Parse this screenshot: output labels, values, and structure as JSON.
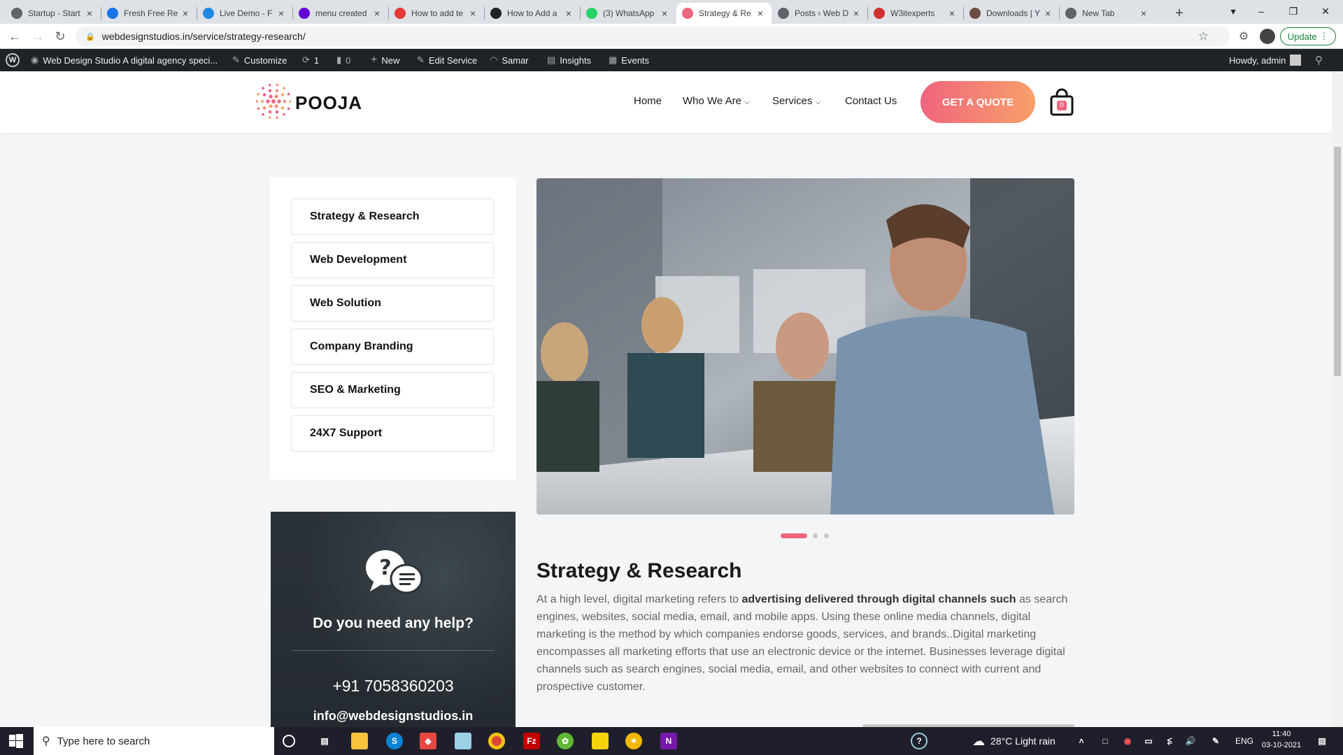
{
  "browser": {
    "tabs": [
      {
        "title": "Startup - Start",
        "icon": "globe-icon",
        "color": "#5f6368"
      },
      {
        "title": "Fresh Free Re",
        "icon": "f-icon",
        "color": "#1a73e8"
      },
      {
        "title": "Live Demo - F",
        "icon": "web-icon",
        "color": "#1e88e5"
      },
      {
        "title": "menu created",
        "icon": "yahoo-icon",
        "color": "#6001d2"
      },
      {
        "title": "How to add te",
        "icon": "adobe-icon",
        "color": "#e53935"
      },
      {
        "title": "How to Add a",
        "icon": "co-icon",
        "color": "#202124"
      },
      {
        "title": "(3) WhatsApp",
        "icon": "whatsapp-icon",
        "color": "#25d366"
      },
      {
        "title": "Strategy & Re",
        "icon": "site-icon",
        "color": "#f0657e",
        "active": true
      },
      {
        "title": "Posts ‹ Web D",
        "icon": "wordpress-icon",
        "color": "#5f6368"
      },
      {
        "title": "W3itexperts",
        "icon": "w-icon",
        "color": "#d32f2f"
      },
      {
        "title": "Downloads | Y",
        "icon": "download-icon",
        "color": "#6d4c41"
      },
      {
        "title": "New Tab",
        "icon": "globe-icon",
        "color": "#5f6368"
      }
    ],
    "new_tab": "+",
    "url": "webdesignstudios.in/service/strategy-research/",
    "update_label": "Update"
  },
  "wpbar": {
    "site": "Web Design Studio A digital agency speci...",
    "customize": "Customize",
    "updates": "1",
    "comments": "0",
    "new": "New",
    "edit": "Edit Service",
    "samar": "Samar",
    "insights": "Insights",
    "events": "Events",
    "howdy": "Howdy, admin"
  },
  "site": {
    "logo": "POOJA",
    "nav": [
      "Home",
      "Who We Are",
      "Services",
      "Contact Us"
    ],
    "quote": "GET A QUOTE",
    "cart_count": "0"
  },
  "services": [
    "Strategy & Research",
    "Web Development",
    "Web Solution",
    "Company Branding",
    "SEO & Marketing",
    "24X7 Support"
  ],
  "help": {
    "title": "Do you need any help?",
    "phone": "+91 7058360203",
    "email": "info@webdesignstudios.in"
  },
  "main": {
    "title": "Strategy & Research",
    "para_pre": "At a high level, digital marketing refers to ",
    "para_bold": "advertising delivered through digital channels such",
    "para_post": " as search engines, websites, social media, email, and mobile apps. Using these online media channels, digital marketing is the method by which companies endorse goods, services, and brands..Digital marketing encompasses all marketing efforts that use an electronic device or the internet. Businesses leverage digital channels such as search engines, social media, email, and other websites to connect with current and prospective customer."
  },
  "taskbar": {
    "search_placeholder": "Type here to search",
    "weather": "28°C  Light rain",
    "lang": "ENG",
    "time": "11:40",
    "date": "03-10-2021"
  },
  "colors": {
    "accent": "#f0657e",
    "accent2": "#f8a06a",
    "dark": "#1d2327"
  }
}
